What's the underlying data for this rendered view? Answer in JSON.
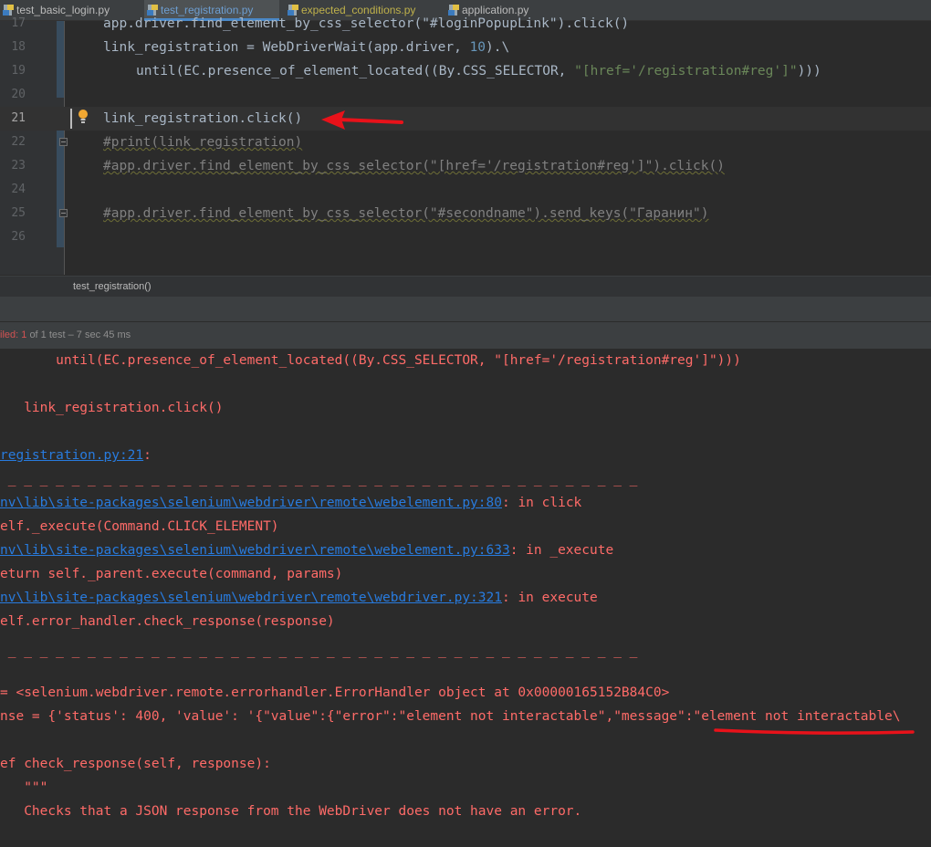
{
  "tabs": [
    {
      "label": "test_basic_login.py",
      "active": false,
      "color": "#bbbbbb"
    },
    {
      "label": "test_registration.py",
      "active": true,
      "color": "#6d9ed1"
    },
    {
      "label": "expected_conditions.py",
      "active": false,
      "color": "#bfb14b"
    },
    {
      "label": "application.py",
      "active": false,
      "color": "#bbbbbb"
    }
  ],
  "editor": {
    "lines": [
      {
        "num": "17",
        "text": "app.driver.find_element_by_css_selector(\"#loginPopupLink\").click()"
      },
      {
        "num": "18",
        "pre": "link_registration = WebDriverWait(app.driver, ",
        "num_val": "10",
        "post": ").\\"
      },
      {
        "num": "19",
        "pre": "until(EC.presence_of_element_located((By.CSS_SELECTOR, ",
        "str": "\"[href='/registration#reg']\"",
        "post": ")))"
      },
      {
        "num": "20",
        "text": ""
      },
      {
        "num": "21",
        "text": "link_registration.click()"
      },
      {
        "num": "22",
        "text": "#print(link_registration)"
      },
      {
        "num": "23",
        "text": "#app.driver.find_element_by_css_selector(\"[href='/registration#reg']\").click()"
      },
      {
        "num": "24",
        "text": ""
      },
      {
        "num": "25",
        "text": "#app.driver.find_element_by_css_selector(\"#secondname\").send_keys(\"Гаранин\")"
      },
      {
        "num": "26",
        "text": ""
      }
    ]
  },
  "breadcrumb": "test_registration()",
  "run_status": {
    "failed": "iled:",
    "count": "1",
    "rest": "of 1 test – 7 sec 45 ms"
  },
  "console": {
    "l1": "       until(EC.presence_of_element_located((By.CSS_SELECTOR, \"[href='/registration#reg']\")))",
    "l2": "   link_registration.click()",
    "l3_link": "registration.py:21",
    "l3_tail": ":",
    "dashes": " _ _ _ _ _ _ _ _ _ _ _ _ _ _ _ _ _ _ _ _ _ _ _ _ _ _ _ _ _ _ _ _ _ _ _ _ _ _ _ _",
    "l5_link": "nv\\lib\\site-packages\\selenium\\webdriver\\remote\\webelement.py:80",
    "l5_tail": ": in click",
    "l6": "elf._execute(Command.CLICK_ELEMENT)",
    "l7_link": "nv\\lib\\site-packages\\selenium\\webdriver\\remote\\webelement.py:633",
    "l7_tail": ": in _execute",
    "l8": "eturn self._parent.execute(command, params)",
    "l9_link": "nv\\lib\\site-packages\\selenium\\webdriver\\remote\\webdriver.py:321",
    "l9_tail": ": in execute",
    "l10": "elf.error_handler.check_response(response)",
    "l12": "= <selenium.webdriver.remote.errorhandler.ErrorHandler object at 0x00000165152B84C0>",
    "l13": "nse = {'status': 400, 'value': '{\"value\":{\"error\":\"element not interactable\",\"message\":\"element not interactable\\",
    "l14": "ef check_response(self, response):",
    "l15": "   \"\"\"",
    "l16": "   Checks that a JSON response from the WebDriver does not have an error."
  },
  "colors": {
    "error_text": "#ff6b68",
    "link": "#287bde",
    "annotation_red": "#e8121a",
    "keyword_number": "#6897bb",
    "string": "#6a8759",
    "comment": "#808080"
  },
  "icons": {
    "tab_file": "python-file-icon",
    "bulb": "lightbulb-icon",
    "fold": "fold-marker-icon"
  }
}
